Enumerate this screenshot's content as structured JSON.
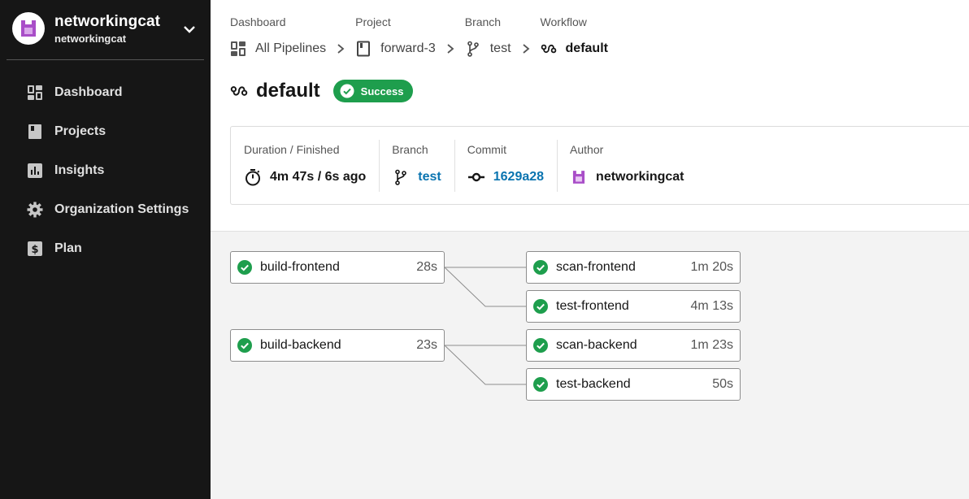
{
  "org": {
    "name": "networkingcat",
    "sub": "networkingcat"
  },
  "nav": {
    "dashboard": "Dashboard",
    "projects": "Projects",
    "insights": "Insights",
    "org_settings": "Organization Settings",
    "plan": "Plan"
  },
  "breadcrumbs": {
    "dashboard": {
      "label": "Dashboard",
      "value": "All Pipelines"
    },
    "project": {
      "label": "Project",
      "value": "forward-3"
    },
    "branch": {
      "label": "Branch",
      "value": "test"
    },
    "workflow": {
      "label": "Workflow",
      "value": "default"
    }
  },
  "workflow": {
    "title": "default",
    "status": "Success"
  },
  "info": {
    "duration": {
      "label": "Duration / Finished",
      "value": "4m 47s / 6s ago"
    },
    "branch": {
      "label": "Branch",
      "value": "test"
    },
    "commit": {
      "label": "Commit",
      "value": "1629a28"
    },
    "author": {
      "label": "Author",
      "value": "networkingcat"
    }
  },
  "jobs": {
    "build_frontend": {
      "name": "build-frontend",
      "duration": "28s"
    },
    "scan_frontend": {
      "name": "scan-frontend",
      "duration": "1m 20s"
    },
    "test_frontend": {
      "name": "test-frontend",
      "duration": "4m 13s"
    },
    "build_backend": {
      "name": "build-backend",
      "duration": "23s"
    },
    "scan_backend": {
      "name": "scan-backend",
      "duration": "1m 23s"
    },
    "test_backend": {
      "name": "test-backend",
      "duration": "50s"
    }
  },
  "colors": {
    "success": "#1e9e4d",
    "link": "#0a74b0",
    "sidebar": "#161616",
    "avatar": "#a94ec8"
  }
}
